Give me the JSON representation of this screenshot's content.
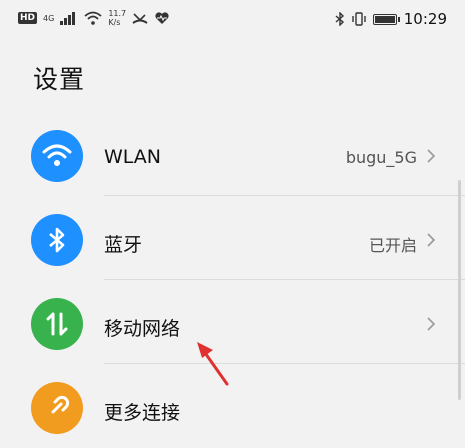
{
  "status_bar": {
    "hd": "HD",
    "net": "4G",
    "speed_value": "11.7",
    "speed_unit": "K/s",
    "time": "10:29",
    "battery_level": 0.9
  },
  "page_title": "设置",
  "items": [
    {
      "label": "WLAN",
      "value": "bugu_5G",
      "icon": "wifi-icon",
      "color": "#1e90ff"
    },
    {
      "label": "蓝牙",
      "value": "已开启",
      "icon": "bluetooth-icon",
      "color": "#1e90ff"
    },
    {
      "label": "移动网络",
      "value": "",
      "icon": "mobile-data-icon",
      "color": "#37b24d"
    },
    {
      "label": "更多连接",
      "value": "",
      "icon": "link-icon",
      "color": "#f29c1f"
    }
  ],
  "colors": {
    "background": "#f2f2f2",
    "arrow": "#e03131"
  }
}
